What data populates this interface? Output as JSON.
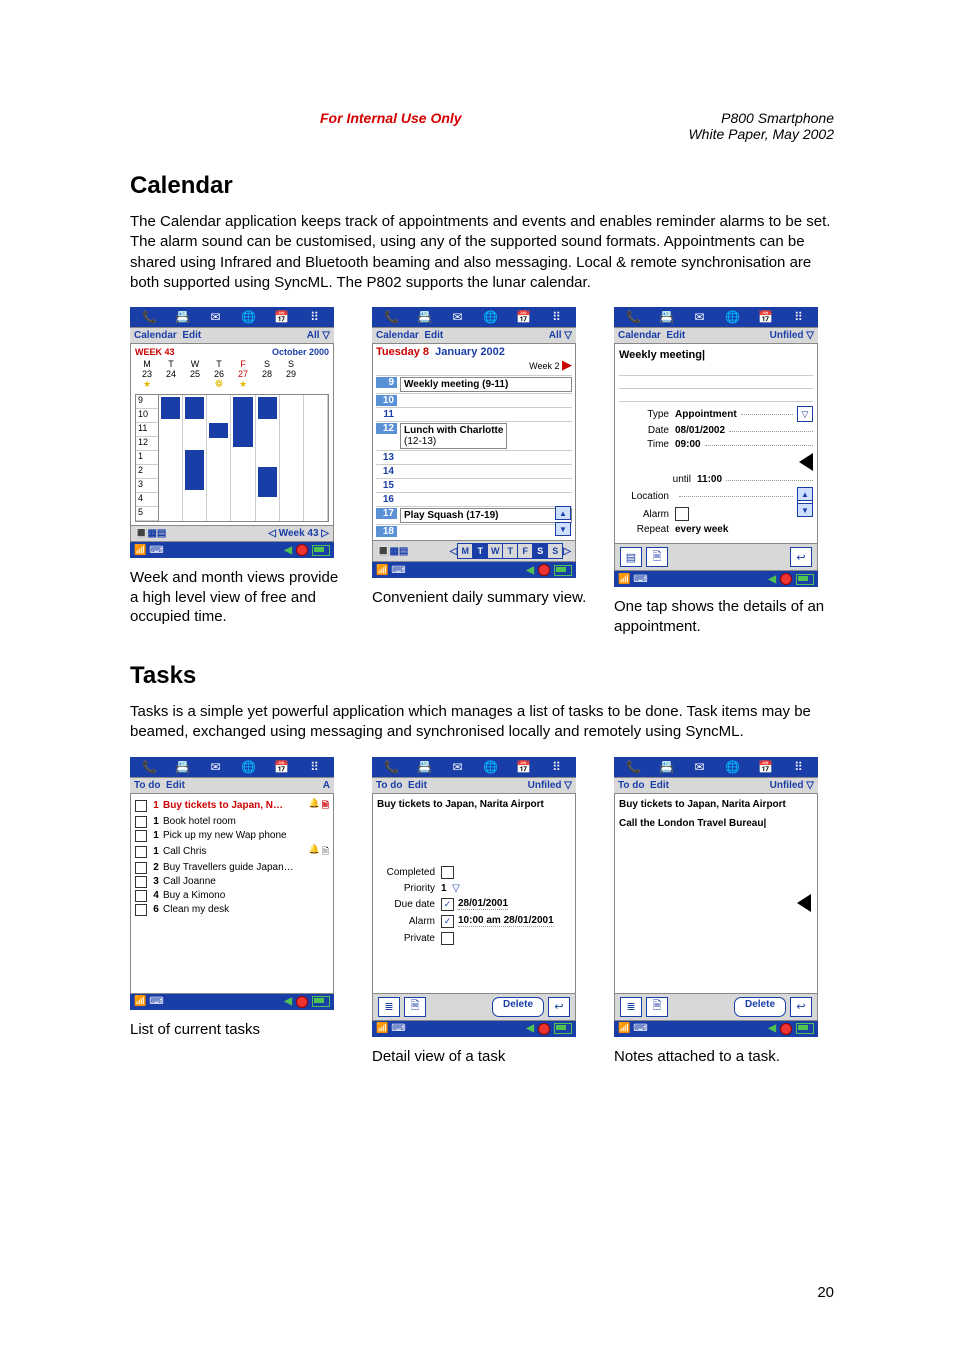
{
  "header": {
    "internal": "For Internal Use Only",
    "title1": "P800 Smartphone",
    "title2": "White Paper, May 2002"
  },
  "pagenum": "20",
  "calendarSection": {
    "heading": "Calendar",
    "para": "The Calendar application keeps track of appointments and events and enables reminder alarms to be set. The alarm sound can be customised, using any of the supported sound formats. Appointments can be shared using Infrared and Bluetooth beaming and also messaging. Local & remote synchronisation are both supported using SyncML. The P802 supports the lunar calendar.",
    "cap1": "Week and month views provide a high level view of free and occupied time.",
    "cap2": "Convenient daily summary view.",
    "cap3": "One tap shows the details of an appointment."
  },
  "tasksSection": {
    "heading": "Tasks",
    "para": "Tasks is a simple yet powerful application which manages a list of tasks to be done. Task items may be beamed, exchanged using messaging and synchronised locally and remotely using SyncML.",
    "cap1": "List of current tasks",
    "cap2": "Detail view of a task",
    "cap3": "Notes attached to a task."
  },
  "common": {
    "menu_calendar": "Calendar",
    "menu_edit": "Edit",
    "menu_all": "All ▽",
    "menu_unfiled": "Unfiled ▽",
    "menu_todo": "To do",
    "delete_btn": "Delete"
  },
  "cal1": {
    "week_label": "WEEK 43",
    "month_label": "October 2000",
    "days": [
      "M",
      "T",
      "W",
      "T",
      "F",
      "S",
      "S"
    ],
    "nums": [
      "23",
      "24",
      "25",
      "26",
      "27",
      "28",
      "29"
    ],
    "hours": [
      "9",
      "10",
      "11",
      "12",
      "1",
      "2",
      "3",
      "4",
      "5"
    ],
    "foot": "◁ Week 43 ▷"
  },
  "cal2": {
    "day": "Tuesday 8",
    "month": "January 2002",
    "week": "Week 2",
    "h9": "9",
    "e9": "Weekly meeting (9-11)",
    "h10": "10",
    "h11": "11",
    "h12": "12",
    "e12a": "Lunch with Charlotte",
    "e12b": "(12-13)",
    "h13": "13",
    "h14": "14",
    "h15": "15",
    "h16": "16",
    "h17": "17",
    "e17": "Play Squash (17-19)",
    "h18": "18",
    "daybar": [
      "M",
      "T",
      "W",
      "T",
      "F",
      "S",
      "S"
    ]
  },
  "cal3": {
    "title": "Weekly meeting|",
    "type_l": "Type",
    "type_v": "Appointment",
    "date_l": "Date",
    "date_v": "08/01/2002",
    "time_l": "Time",
    "time_v": "09:00",
    "until_l": "until",
    "until_v": "11:00",
    "loc_l": "Location",
    "alarm_l": "Alarm",
    "repeat_l": "Repeat",
    "repeat_v": "every week"
  },
  "tasks1": {
    "sort": "A",
    "items": [
      {
        "pr": "1",
        "txt": "Buy tickets to Japan, N…",
        "red": true,
        "bell": true,
        "note": true
      },
      {
        "pr": "1",
        "txt": "Book hotel room"
      },
      {
        "pr": "1",
        "txt": "Pick up my new Wap phone"
      },
      {
        "pr": "1",
        "txt": "Call Chris",
        "bell": true,
        "note": true
      },
      {
        "pr": "2",
        "txt": "Buy Travellers guide Japan…"
      },
      {
        "pr": "3",
        "txt": "Call Joanne"
      },
      {
        "pr": "4",
        "txt": "Buy a Kimono"
      },
      {
        "pr": "6",
        "txt": "Clean my desk"
      }
    ]
  },
  "tasks2": {
    "title": "Buy tickets to Japan, Narita Airport",
    "completed_l": "Completed",
    "priority_l": "Priority",
    "priority_v": "1",
    "due_l": "Due date",
    "due_v": "28/01/2001",
    "alarm_l": "Alarm",
    "alarm_v": "10:00 am   28/01/2001",
    "private_l": "Private"
  },
  "tasks3": {
    "title": "Buy tickets to Japan, Narita Airport",
    "note": "Call the London Travel Bureau|"
  }
}
